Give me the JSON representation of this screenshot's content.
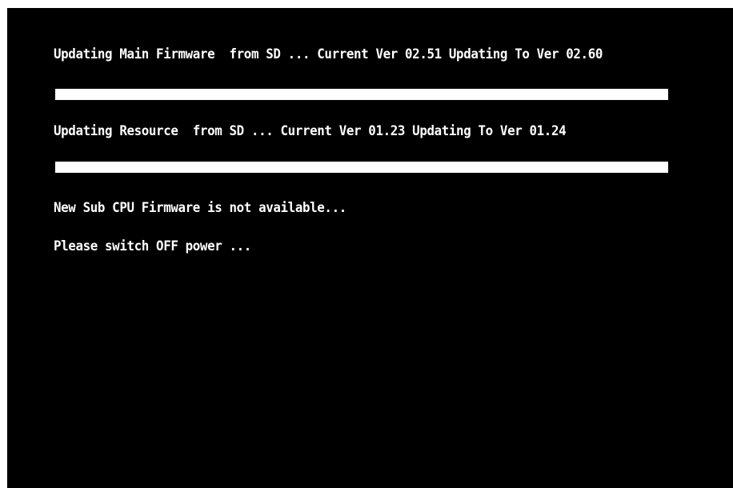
{
  "lines": {
    "main_firmware": "Updating Main Firmware  from SD ... Current Ver 02.51 Updating To Ver 02.60",
    "resource": "Updating Resource  from SD ... Current Ver 01.23 Updating To Ver 01.24",
    "sub_cpu": "New Sub CPU Firmware is not available...",
    "switch_off": "Please switch OFF power ..."
  },
  "progress": {
    "main_firmware": 1.0,
    "resource": 1.0
  },
  "colors": {
    "background": "#000000",
    "text": "#ffffff",
    "bar": "#ffffff"
  }
}
